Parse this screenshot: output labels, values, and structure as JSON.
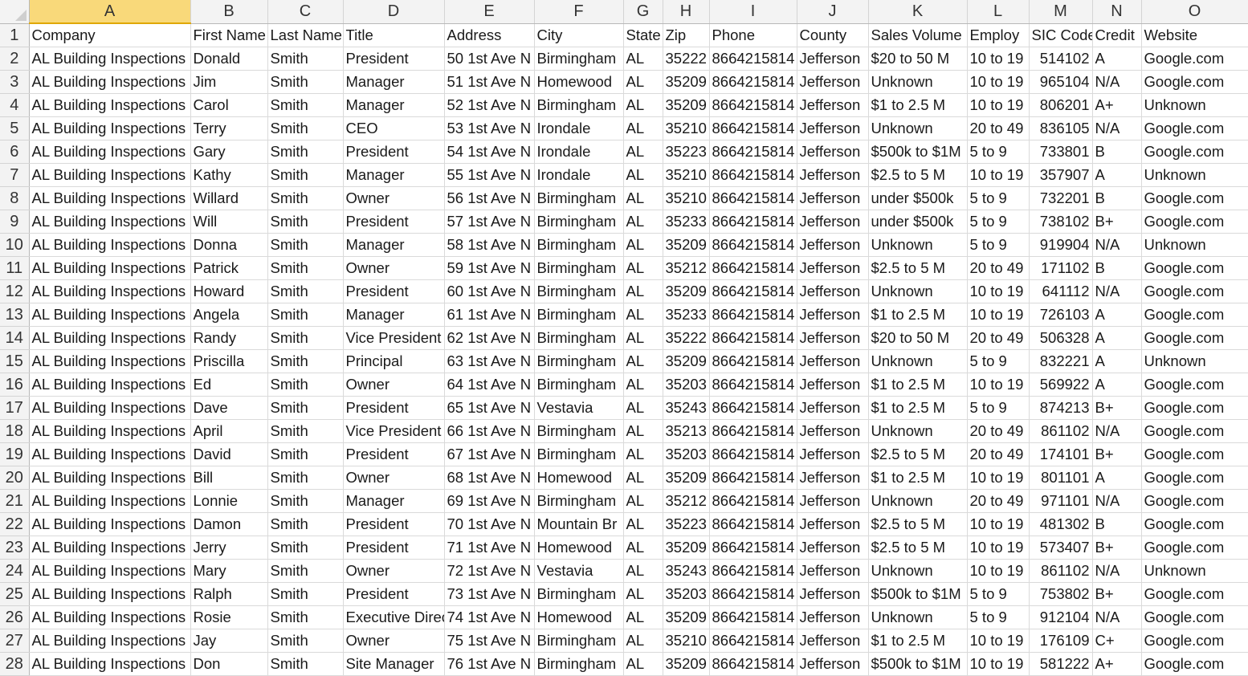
{
  "sheet": {
    "columns": [
      "A",
      "B",
      "C",
      "D",
      "E",
      "F",
      "G",
      "H",
      "I",
      "J",
      "K",
      "L",
      "M",
      "N",
      "O"
    ],
    "active_column": "A",
    "rows": [
      [
        "Company",
        "First Name",
        "Last Name",
        "Title",
        "Address",
        "City",
        "State",
        "Zip",
        "Phone",
        "County",
        "Sales Volume",
        "Employ",
        "SIC Code",
        "Credit",
        "Website"
      ],
      [
        "AL Building Inspections",
        "Donald",
        "Smith",
        "President",
        "50 1st Ave N",
        "Birmingham",
        "AL",
        "35222",
        "8664215814",
        "Jefferson",
        "$20 to 50 M",
        "10 to 19",
        "514102",
        "A",
        "Google.com"
      ],
      [
        "AL Building Inspections",
        "Jim",
        "Smith",
        "Manager",
        "51 1st Ave N",
        "Homewood",
        "AL",
        "35209",
        "8664215814",
        "Jefferson",
        "Unknown",
        "10 to 19",
        "965104",
        "N/A",
        "Google.com"
      ],
      [
        "AL Building Inspections",
        "Carol",
        "Smith",
        "Manager",
        "52 1st Ave N",
        "Birmingham",
        "AL",
        "35209",
        "8664215814",
        "Jefferson",
        "$1 to 2.5 M",
        "10 to 19",
        "806201",
        "A+",
        "Unknown"
      ],
      [
        "AL Building Inspections",
        "Terry",
        "Smith",
        "CEO",
        "53 1st Ave N",
        "Irondale",
        "AL",
        "35210",
        "8664215814",
        "Jefferson",
        "Unknown",
        "20 to 49",
        "836105",
        "N/A",
        "Google.com"
      ],
      [
        "AL Building Inspections",
        "Gary",
        "Smith",
        "President",
        "54 1st Ave N",
        "Irondale",
        "AL",
        "35223",
        "8664215814",
        "Jefferson",
        "$500k to $1M",
        "5 to 9",
        "733801",
        "B",
        "Google.com"
      ],
      [
        "AL Building Inspections",
        "Kathy",
        "Smith",
        "Manager",
        "55 1st Ave N",
        "Irondale",
        "AL",
        "35210",
        "8664215814",
        "Jefferson",
        "$2.5 to 5 M",
        "10 to 19",
        "357907",
        "A",
        "Unknown"
      ],
      [
        "AL Building Inspections",
        "Willard",
        "Smith",
        "Owner",
        "56 1st Ave N",
        "Birmingham",
        "AL",
        "35210",
        "8664215814",
        "Jefferson",
        "under $500k",
        "5 to 9",
        "732201",
        "B",
        "Google.com"
      ],
      [
        "AL Building Inspections",
        "Will",
        "Smith",
        "President",
        "57 1st Ave N",
        "Birmingham",
        "AL",
        "35233",
        "8664215814",
        "Jefferson",
        "under $500k",
        "5 to 9",
        "738102",
        "B+",
        "Google.com"
      ],
      [
        "AL Building Inspections",
        "Donna",
        "Smith",
        "Manager",
        "58 1st Ave N",
        "Birmingham",
        "AL",
        "35209",
        "8664215814",
        "Jefferson",
        "Unknown",
        "5 to 9",
        "919904",
        "N/A",
        "Unknown"
      ],
      [
        "AL Building Inspections",
        "Patrick",
        "Smith",
        "Owner",
        "59 1st Ave N",
        "Birmingham",
        "AL",
        "35212",
        "8664215814",
        "Jefferson",
        "$2.5 to 5 M",
        "20 to 49",
        "171102",
        "B",
        "Google.com"
      ],
      [
        "AL Building Inspections",
        "Howard",
        "Smith",
        "President",
        "60 1st Ave N",
        "Birmingham",
        "AL",
        "35209",
        "8664215814",
        "Jefferson",
        "Unknown",
        "10 to 19",
        "641112",
        "N/A",
        "Google.com"
      ],
      [
        "AL Building Inspections",
        "Angela",
        "Smith",
        "Manager",
        "61 1st Ave N",
        "Birmingham",
        "AL",
        "35233",
        "8664215814",
        "Jefferson",
        "$1 to 2.5 M",
        "10 to 19",
        "726103",
        "A",
        "Google.com"
      ],
      [
        "AL Building Inspections",
        "Randy",
        "Smith",
        "Vice President",
        "62 1st Ave N",
        "Birmingham",
        "AL",
        "35222",
        "8664215814",
        "Jefferson",
        "$20 to 50 M",
        "20 to 49",
        "506328",
        "A",
        "Google.com"
      ],
      [
        "AL Building Inspections",
        "Priscilla",
        "Smith",
        "Principal",
        "63 1st Ave N",
        "Birmingham",
        "AL",
        "35209",
        "8664215814",
        "Jefferson",
        "Unknown",
        "5 to 9",
        "832221",
        "A",
        "Unknown"
      ],
      [
        "AL Building Inspections",
        "Ed",
        "Smith",
        "Owner",
        "64 1st Ave N",
        "Birmingham",
        "AL",
        "35203",
        "8664215814",
        "Jefferson",
        "$1 to 2.5 M",
        "10 to 19",
        "569922",
        "A",
        "Google.com"
      ],
      [
        "AL Building Inspections",
        "Dave",
        "Smith",
        "President",
        "65 1st Ave N",
        "Vestavia",
        "AL",
        "35243",
        "8664215814",
        "Jefferson",
        "$1 to 2.5 M",
        "5 to 9",
        "874213",
        "B+",
        "Google.com"
      ],
      [
        "AL Building Inspections",
        "April",
        "Smith",
        "Vice President",
        "66 1st Ave N",
        "Birmingham",
        "AL",
        "35213",
        "8664215814",
        "Jefferson",
        "Unknown",
        "20 to 49",
        "861102",
        "N/A",
        "Google.com"
      ],
      [
        "AL Building Inspections",
        "David",
        "Smith",
        "President",
        "67 1st Ave N",
        "Birmingham",
        "AL",
        "35203",
        "8664215814",
        "Jefferson",
        "$2.5 to 5 M",
        "20 to 49",
        "174101",
        "B+",
        "Google.com"
      ],
      [
        "AL Building Inspections",
        "Bill",
        "Smith",
        "Owner",
        "68 1st Ave N",
        "Homewood",
        "AL",
        "35209",
        "8664215814",
        "Jefferson",
        "$1 to 2.5 M",
        "10 to 19",
        "801101",
        "A",
        "Google.com"
      ],
      [
        "AL Building Inspections",
        "Lonnie",
        "Smith",
        "Manager",
        "69 1st Ave N",
        "Birmingham",
        "AL",
        "35212",
        "8664215814",
        "Jefferson",
        "Unknown",
        "20 to 49",
        "971101",
        "N/A",
        "Google.com"
      ],
      [
        "AL Building Inspections",
        "Damon",
        "Smith",
        "President",
        "70 1st Ave N",
        "Mountain Br",
        "AL",
        "35223",
        "8664215814",
        "Jefferson",
        "$2.5 to 5 M",
        "10 to 19",
        "481302",
        "B",
        "Google.com"
      ],
      [
        "AL Building Inspections",
        "Jerry",
        "Smith",
        "President",
        "71 1st Ave N",
        "Homewood",
        "AL",
        "35209",
        "8664215814",
        "Jefferson",
        "$2.5 to 5 M",
        "10 to 19",
        "573407",
        "B+",
        "Google.com"
      ],
      [
        "AL Building Inspections",
        "Mary",
        "Smith",
        "Owner",
        "72 1st Ave N",
        "Vestavia",
        "AL",
        "35243",
        "8664215814",
        "Jefferson",
        "Unknown",
        "10 to 19",
        "861102",
        "N/A",
        "Unknown"
      ],
      [
        "AL Building Inspections",
        "Ralph",
        "Smith",
        "President",
        "73 1st Ave N",
        "Birmingham",
        "AL",
        "35203",
        "8664215814",
        "Jefferson",
        "$500k to $1M",
        "5 to 9",
        "753802",
        "B+",
        "Google.com"
      ],
      [
        "AL Building Inspections",
        "Rosie",
        "Smith",
        "Executive Direc",
        "74 1st Ave N",
        "Homewood",
        "AL",
        "35209",
        "8664215814",
        "Jefferson",
        "Unknown",
        "5 to 9",
        "912104",
        "N/A",
        "Google.com"
      ],
      [
        "AL Building Inspections",
        "Jay",
        "Smith",
        "Owner",
        "75 1st Ave N",
        "Birmingham",
        "AL",
        "35210",
        "8664215814",
        "Jefferson",
        "$1 to 2.5 M",
        "10 to 19",
        "176109",
        "C+",
        "Google.com"
      ],
      [
        "AL Building Inspections",
        "Don",
        "Smith",
        "Site Manager",
        "76 1st Ave N",
        "Birmingham",
        "AL",
        "35209",
        "8664215814",
        "Jefferson",
        "$500k to $1M",
        "10 to 19",
        "581222",
        "A+",
        "Google.com"
      ]
    ]
  }
}
